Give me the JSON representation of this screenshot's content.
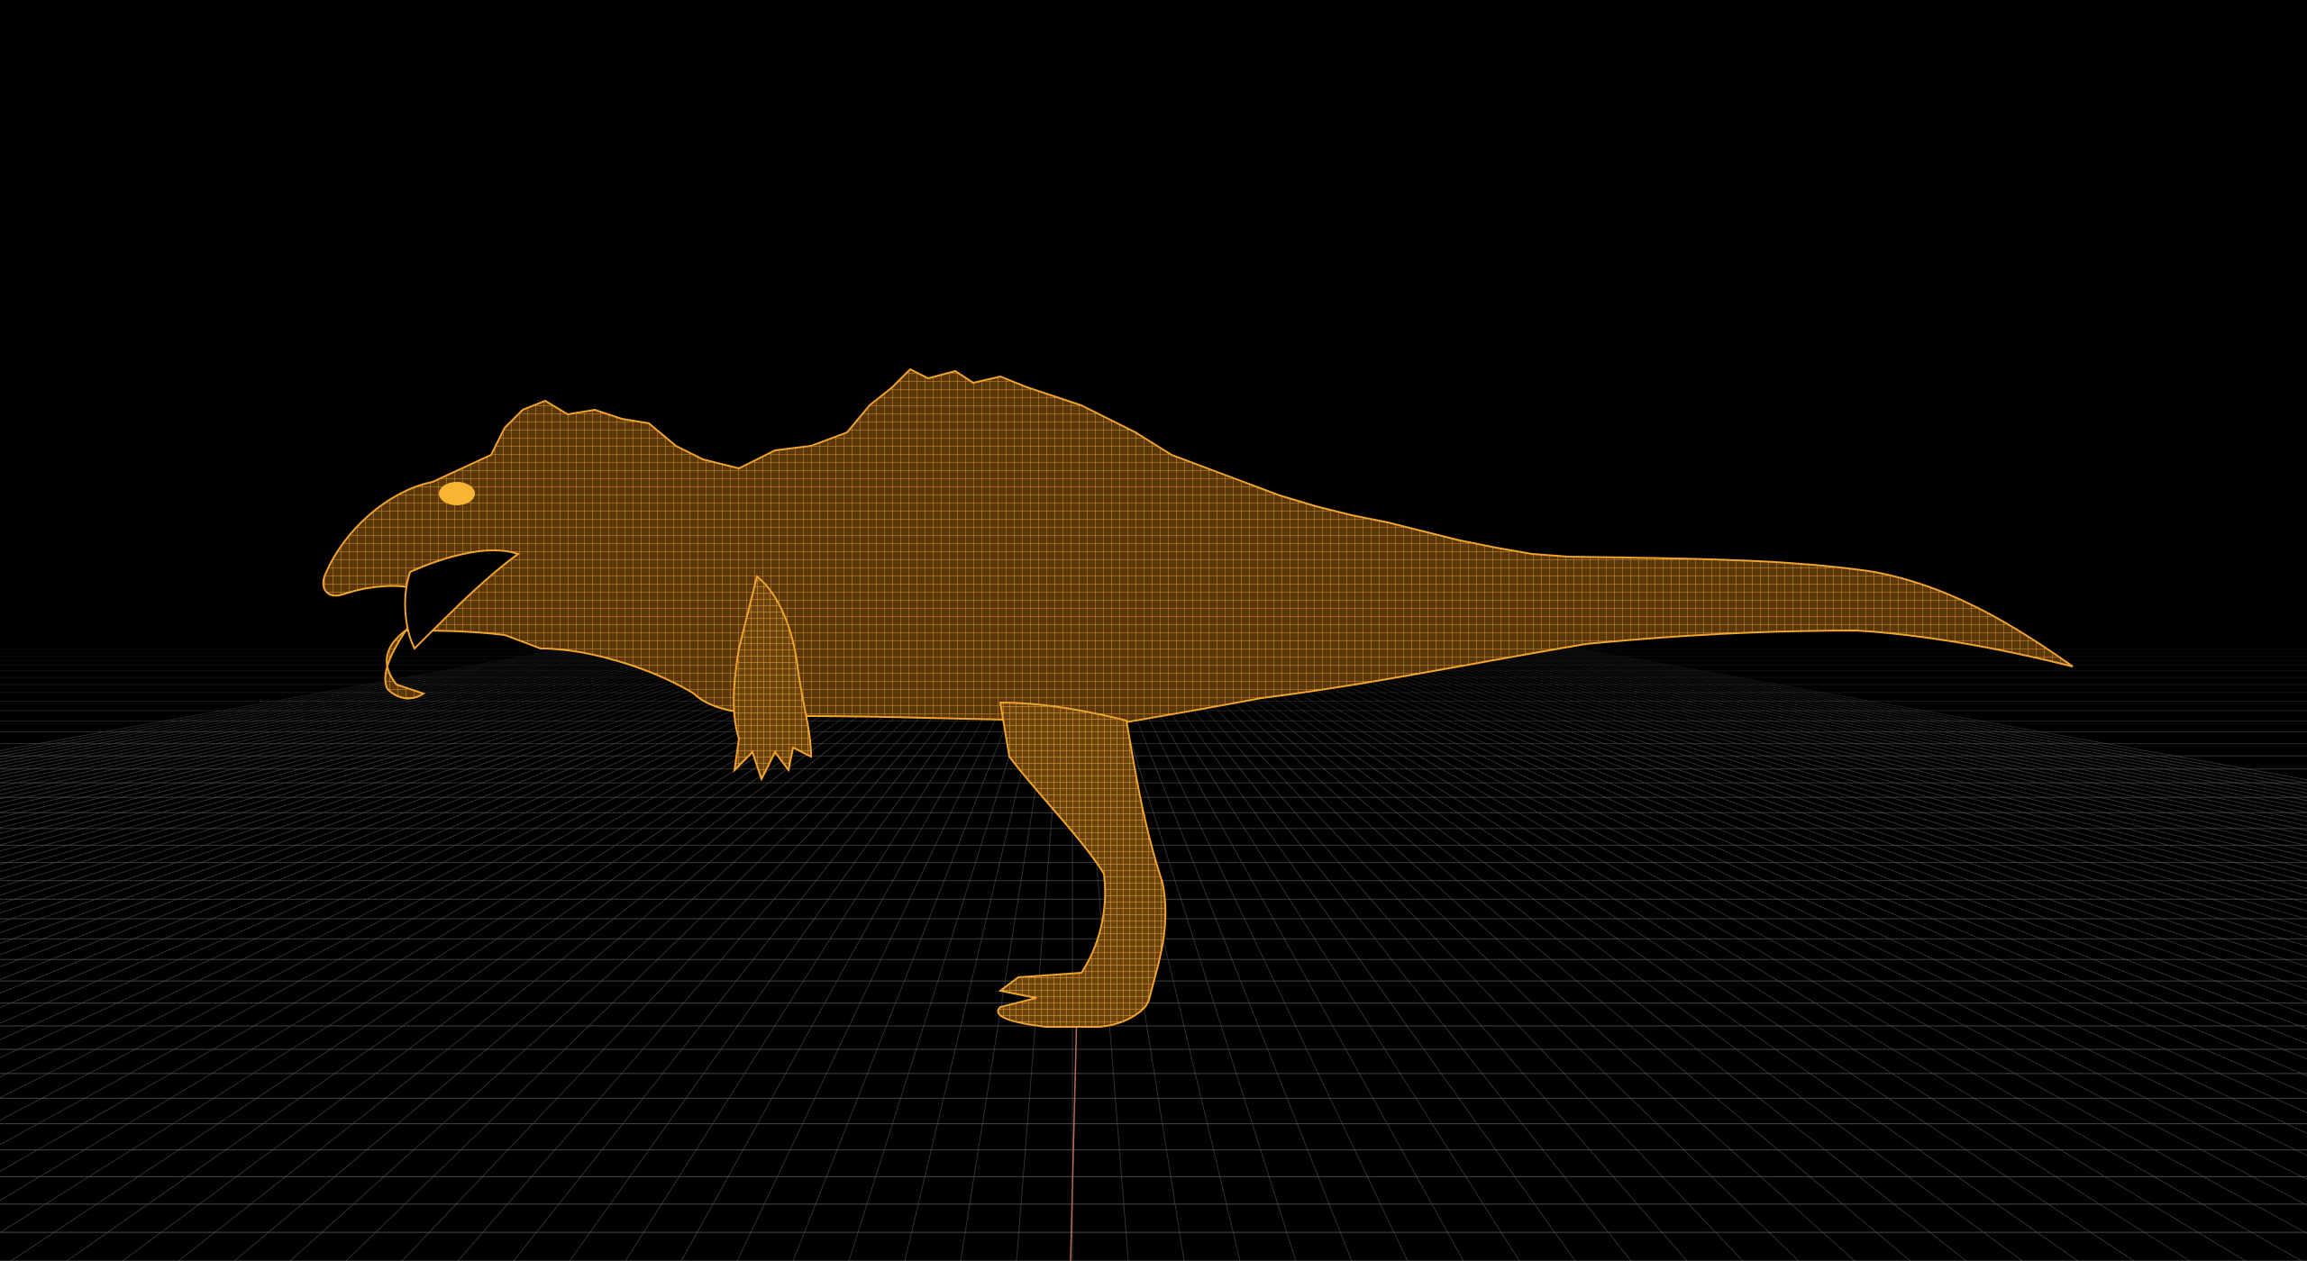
{
  "viewport": {
    "background": "#000000",
    "grid_color": "#5a5a5a",
    "axis_color": "#b86a5a",
    "mesh_color": "#f2a52e",
    "mesh_fill": "#7a4d10",
    "eye_color": "#f7b531"
  },
  "subject": {
    "name": "wireframe-dinosaur",
    "style": "wireframe",
    "view": "side"
  }
}
